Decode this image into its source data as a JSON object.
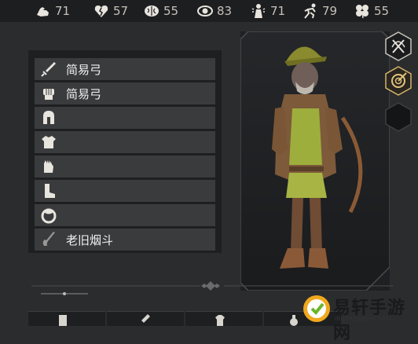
{
  "stats": [
    {
      "icon": "strength-arm-icon",
      "value": "71"
    },
    {
      "icon": "broken-heart-icon",
      "value": "57"
    },
    {
      "icon": "brain-icon",
      "value": "55"
    },
    {
      "icon": "eye-icon",
      "value": "83"
    },
    {
      "icon": "speech-figure-icon",
      "value": "71"
    },
    {
      "icon": "running-figure-icon",
      "value": "79"
    },
    {
      "icon": "clover-icon",
      "value": "55"
    }
  ],
  "equipment": [
    {
      "icon": "sword-icon",
      "label": "简易弓"
    },
    {
      "icon": "fist-icon",
      "label": "简易弓"
    },
    {
      "icon": "helmet-icon",
      "label": ""
    },
    {
      "icon": "chest-armor-icon",
      "label": ""
    },
    {
      "icon": "gauntlet-icon",
      "label": ""
    },
    {
      "icon": "boot-icon",
      "label": ""
    },
    {
      "icon": "ring-icon",
      "label": ""
    },
    {
      "icon": "pipe-icon",
      "label": "老旧烟斗"
    }
  ],
  "side_buttons": [
    "bow-crossed-icon",
    "target-icon",
    "empty-hex-slot"
  ],
  "watermark": {
    "name": "易轩手游网",
    "url": "ibudongguan.com"
  }
}
